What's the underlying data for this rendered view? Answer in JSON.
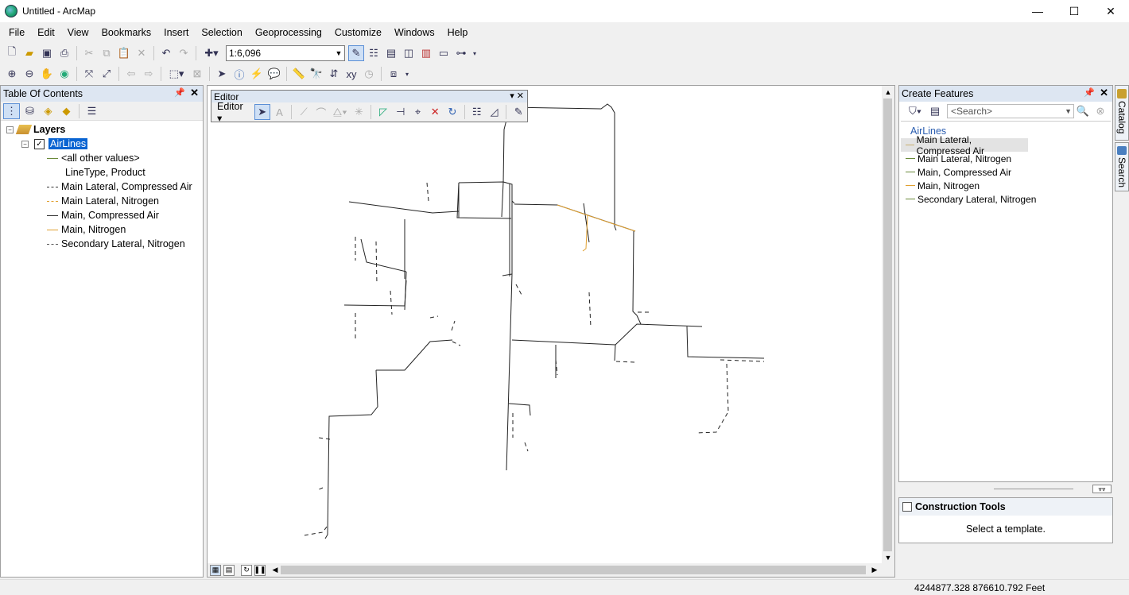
{
  "window": {
    "title": "Untitled - ArcMap",
    "min": "—",
    "max": "☐",
    "close": "✕"
  },
  "menu": [
    "File",
    "Edit",
    "View",
    "Bookmarks",
    "Insert",
    "Selection",
    "Geoprocessing",
    "Customize",
    "Windows",
    "Help"
  ],
  "standard_toolbar": {
    "scale": "1:6,096"
  },
  "toc": {
    "title": "Table Of Contents",
    "root": "Layers",
    "layer": "AirLines",
    "legend": [
      {
        "label": "<all other values>",
        "style": "solid",
        "color": "#6a8a3a"
      },
      {
        "label": "LineType, Product",
        "style": "none",
        "color": ""
      },
      {
        "label": "Main Lateral, Compressed Air",
        "style": "dashed",
        "color": "#333333"
      },
      {
        "label": "Main Lateral, Nitrogen",
        "style": "dashed",
        "color": "#e0a030"
      },
      {
        "label": "Main, Compressed Air",
        "style": "solid",
        "color": "#333333"
      },
      {
        "label": "Main, Nitrogen",
        "style": "solid",
        "color": "#e0a030"
      },
      {
        "label": "Secondary Lateral, Nitrogen",
        "style": "dashed",
        "color": "#555555"
      }
    ]
  },
  "editor": {
    "title": "Editor",
    "menu": "Editor ▾"
  },
  "create_features": {
    "title": "Create Features",
    "search_placeholder": "<Search>",
    "group": "AirLines",
    "templates": [
      "Main Lateral, Compressed Air",
      "Main Lateral, Nitrogen",
      "Main, Compressed Air",
      "Main, Nitrogen",
      "Secondary Lateral, Nitrogen"
    ],
    "selected_index": 0
  },
  "construction_tools": {
    "title": "Construction Tools",
    "message": "Select a template."
  },
  "side_tabs": [
    "Catalog",
    "Search"
  ],
  "status": {
    "coordinates": "4244877.328  876610.792 Feet"
  },
  "colors": {
    "line": "#222222",
    "highlight": "#e0a030",
    "accent": "#2a5db0"
  }
}
